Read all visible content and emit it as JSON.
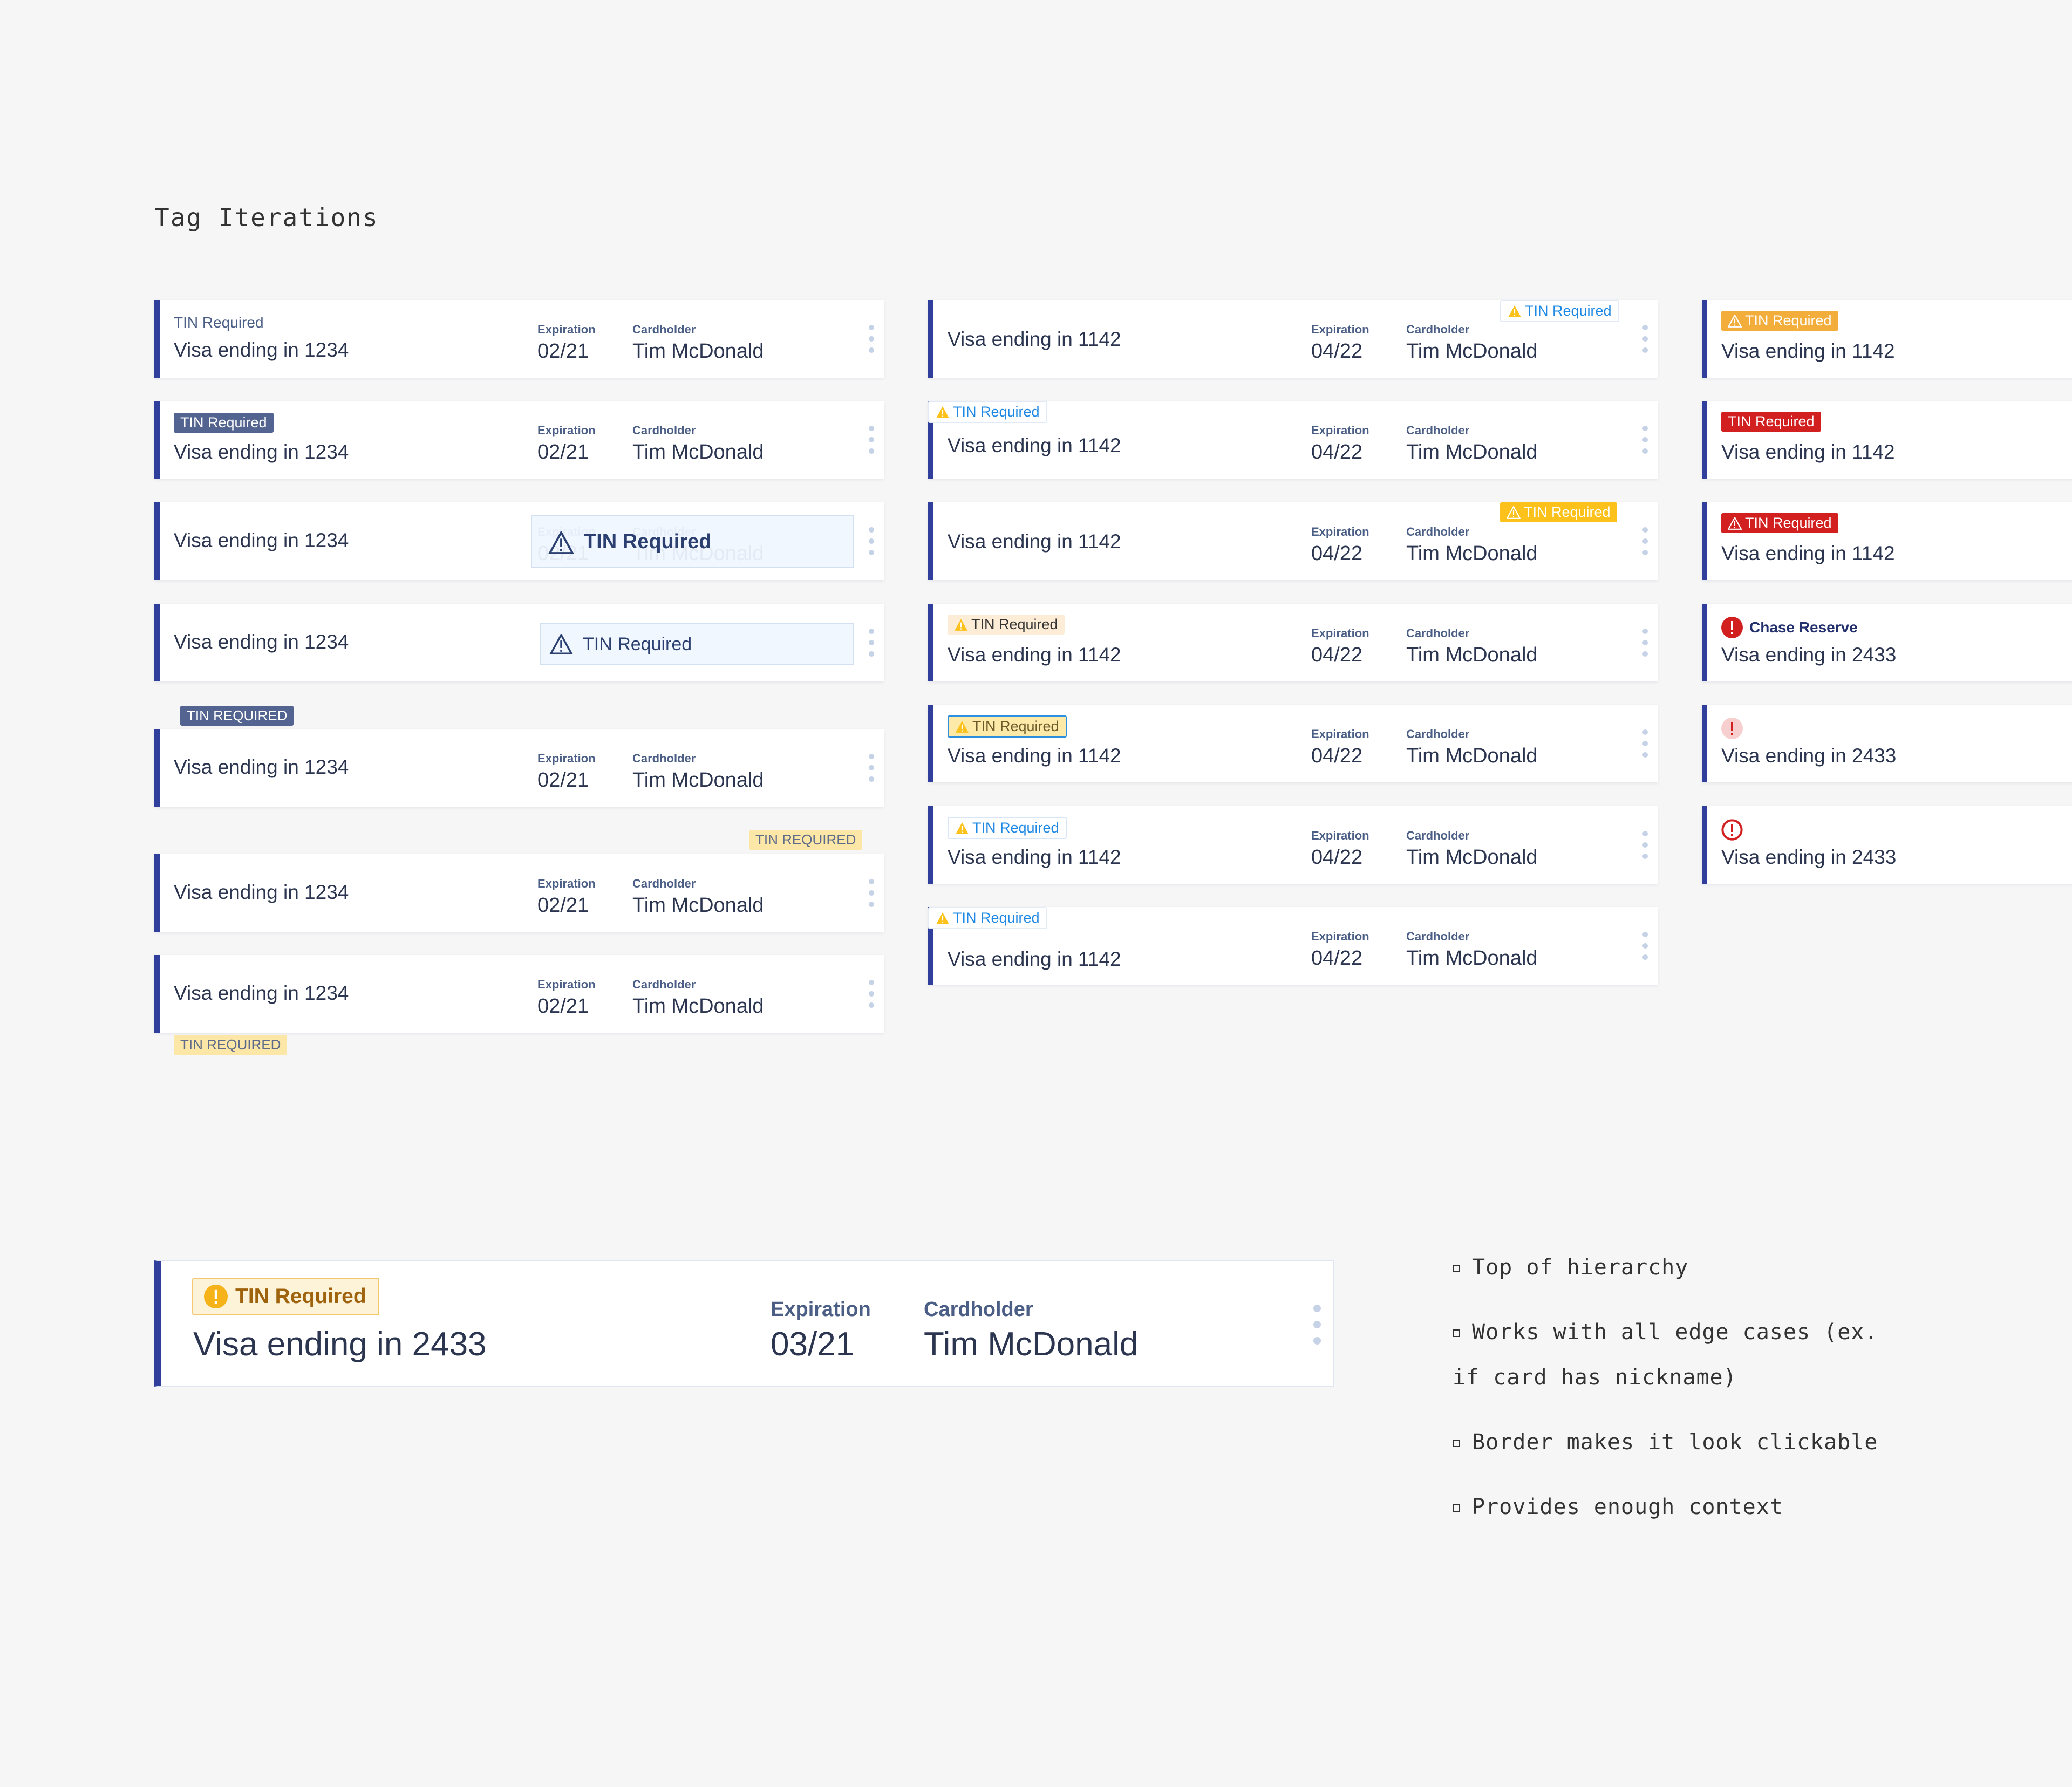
{
  "title": "Tag Iterations",
  "labels": {
    "expiration": "Expiration",
    "cardholder": "Cardholder"
  },
  "col1": {
    "card_name": "Visa ending in 1234",
    "expiration": "02/21",
    "cardholder": "Tim McDonald",
    "tag_title": "TIN Required",
    "tag_upper": "TIN REQUIRED"
  },
  "col2": {
    "card_name": "Visa ending in 1142",
    "expiration": "04/22",
    "cardholder": "Tim McDonald",
    "tag": "TIN Required"
  },
  "col3": {
    "card_name_1142": "Visa ending in 1142",
    "card_name_2433": "Visa ending in 2433",
    "tag": "TIN Required",
    "chase_reserve": "Chase Reserve"
  },
  "final": {
    "tag": "TIN Required",
    "card_name": "Visa ending in 2433",
    "expiration_label": "Expiration",
    "expiration": "03/21",
    "cardholder_label": "Cardholder",
    "cardholder": "Tim McDonald"
  },
  "notes": [
    "Top of hierarchy",
    "Works with all edge cases (ex.",
    "if card has nickname)",
    "Border makes it look clickable",
    "Provides enough context"
  ],
  "colors": {
    "accent": "#2f3f9b",
    "warning_yellow": "#fcc21b",
    "error_red": "#d21f1f",
    "link_blue": "#1e88e5"
  }
}
